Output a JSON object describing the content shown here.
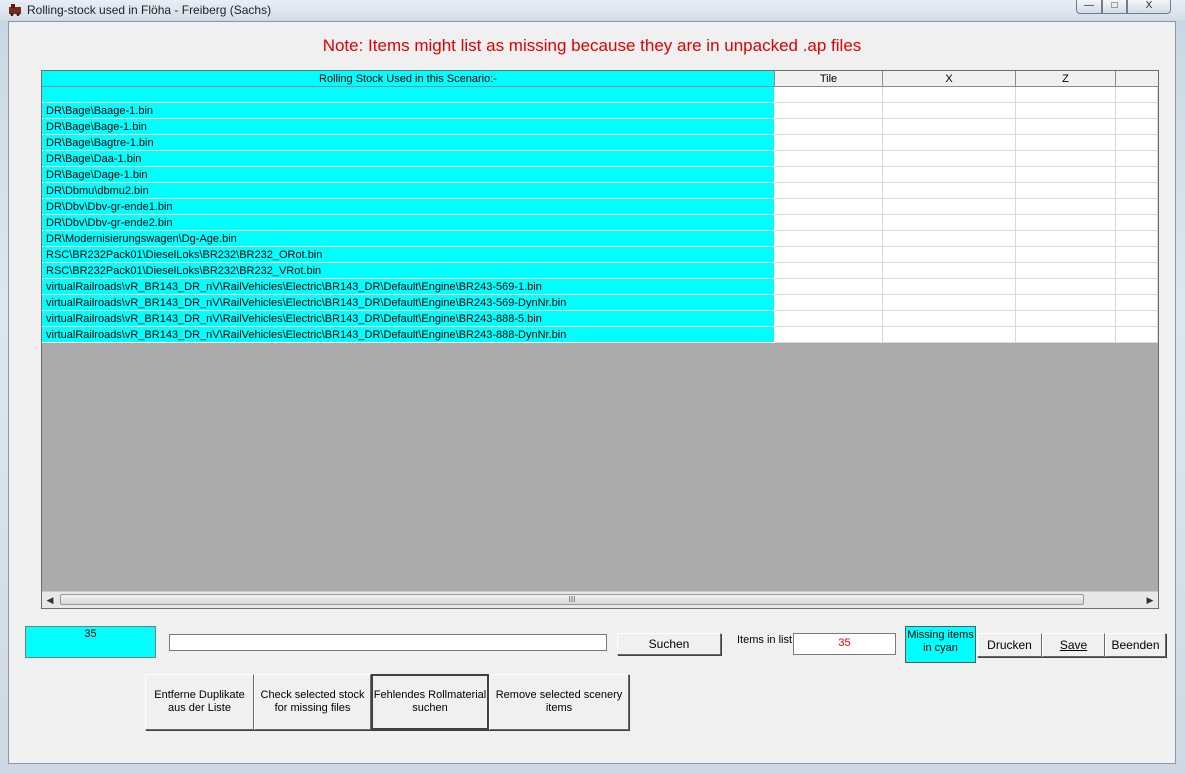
{
  "window": {
    "title": "Rolling-stock used in Flöha - Freiberg (Sachs)",
    "controls": {
      "minimize": "—",
      "maximize": "□",
      "close": "X"
    }
  },
  "note": "Note: Items might list as missing because they are in unpacked .ap files",
  "grid": {
    "headers": [
      "Rolling Stock Used in this Scenario:-",
      "Tile",
      "X",
      "Z",
      ""
    ],
    "rows": [
      "",
      "DR\\Bage\\Baage-1.bin",
      "DR\\Bage\\Bage-1.bin",
      "DR\\Bage\\Bagtre-1.bin",
      "DR\\Bage\\Daa-1.bin",
      "DR\\Bage\\Dage-1.bin",
      "DR\\Dbmu\\dbmu2.bin",
      "DR\\Dbv\\Dbv-gr-ende1.bin",
      "DR\\Dbv\\Dbv-gr-ende2.bin",
      "DR\\Modernisierungswagen\\Dg-Age.bin",
      "RSC\\BR232Pack01\\DieselLoks\\BR232\\BR232_ORot.bin",
      "RSC\\BR232Pack01\\DieselLoks\\BR232\\BR232_VRot.bin",
      "virtualRailroads\\vR_BR143_DR_nV\\RailVehicles\\Electric\\BR143_DR\\Default\\Engine\\BR243-569-1.bin",
      "virtualRailroads\\vR_BR143_DR_nV\\RailVehicles\\Electric\\BR143_DR\\Default\\Engine\\BR243-569-DynNr.bin",
      "virtualRailroads\\vR_BR143_DR_nV\\RailVehicles\\Electric\\BR143_DR\\Default\\Engine\\BR243-888-5.bin",
      "virtualRailroads\\vR_BR143_DR_nV\\RailVehicles\\Electric\\BR143_DR\\Default\\Engine\\BR243-888-DynNr.bin"
    ],
    "scroll_grip": "III"
  },
  "count_box": "35",
  "search": {
    "value": "",
    "button": "Suchen"
  },
  "items_in_list": {
    "label": "Items in list",
    "value": "35"
  },
  "missing_legend": "Missing items in cyan",
  "buttons": {
    "drucken": "Drucken",
    "save": "Save",
    "beenden": "Beenden",
    "remove_duplicates": "Entferne Duplikate aus der Liste",
    "check_selected": "Check selected stock for missing files",
    "find_missing": "Fehlendes Rollmaterial suchen",
    "remove_scenery": "Remove selected scenery items"
  },
  "colors": {
    "missing": "#00ffff",
    "note": "#e00000"
  }
}
